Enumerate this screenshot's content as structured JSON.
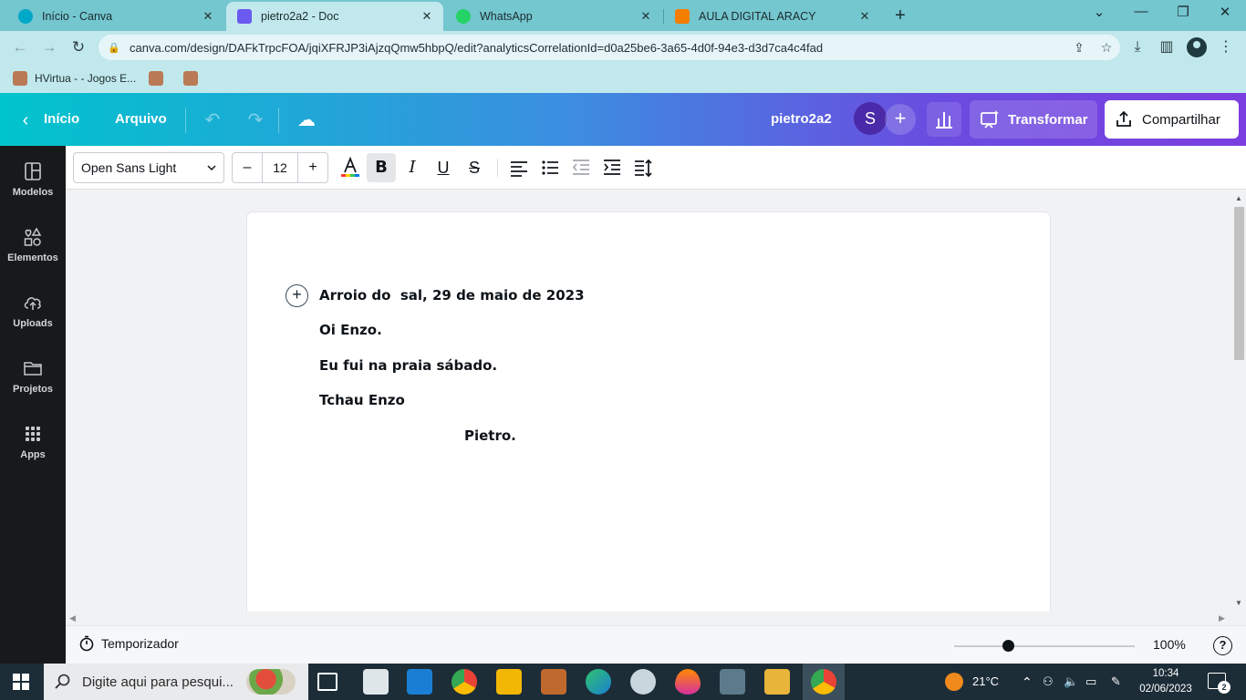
{
  "browser": {
    "tabs": [
      {
        "title": "Início - Canva",
        "icon": "canva-icon",
        "color": "#00c4cc"
      },
      {
        "title": "pietro2a2 - Doc",
        "icon": "canva-doc-icon",
        "color": "#5a4ee0"
      },
      {
        "title": "WhatsApp",
        "icon": "whatsapp-icon",
        "color": "#25d366"
      },
      {
        "title": "AULA DIGITAL ARACY",
        "icon": "blogger-icon",
        "color": "#f57d00"
      }
    ],
    "new_tab": "+",
    "close_glyph": "✕",
    "url": "canva.com/design/DAFkTrpcFOA/jqiXFRJP3iAjzqQmw5hbpQ/edit?analyticsCorrelationId=d0a25be6-3a65-4d0f-94e3-d3d7ca4c4fad",
    "bookmarks": [
      {
        "label": "HVirtua - - Jogos E..."
      },
      {
        "label": ""
      },
      {
        "label": ""
      }
    ]
  },
  "canva": {
    "nav": {
      "home": "Início",
      "file": "Arquivo"
    },
    "doc_title": "pietro2a2",
    "avatar_initial": "S",
    "transform_label": "Transformar",
    "share_label": "Compartilhar",
    "rail": [
      {
        "label": "Modelos",
        "icon": "templates-icon"
      },
      {
        "label": "Elementos",
        "icon": "elements-icon"
      },
      {
        "label": "Uploads",
        "icon": "upload-cloud-icon"
      },
      {
        "label": "Projetos",
        "icon": "folder-icon"
      },
      {
        "label": "Apps",
        "icon": "apps-grid-icon"
      }
    ],
    "toolbar": {
      "font_family": "Open Sans Light",
      "font_size": "12",
      "minus": "–",
      "plus": "+"
    },
    "document": {
      "lines": [
        "Arroio do  sal, 29 de maio de 2023",
        "Oi Enzo.",
        "Eu fui na praia sábado.",
        "Tchau Enzo",
        "Pietro."
      ]
    },
    "footer": {
      "timer_label": "Temporizador",
      "zoom": "100%",
      "zoom_level": 0.3,
      "help": "?"
    }
  },
  "taskbar": {
    "search_placeholder": "Digite aqui para pesqui...",
    "weather": "21°C",
    "time": "10:34",
    "date": "02/06/2023",
    "notifications": "2"
  },
  "colors": {
    "header_gradient_start": "#00c4cc",
    "header_gradient_end": "#7b3ee0",
    "tab_strip": "#74c6cf",
    "rail_bg": "#18191b"
  }
}
